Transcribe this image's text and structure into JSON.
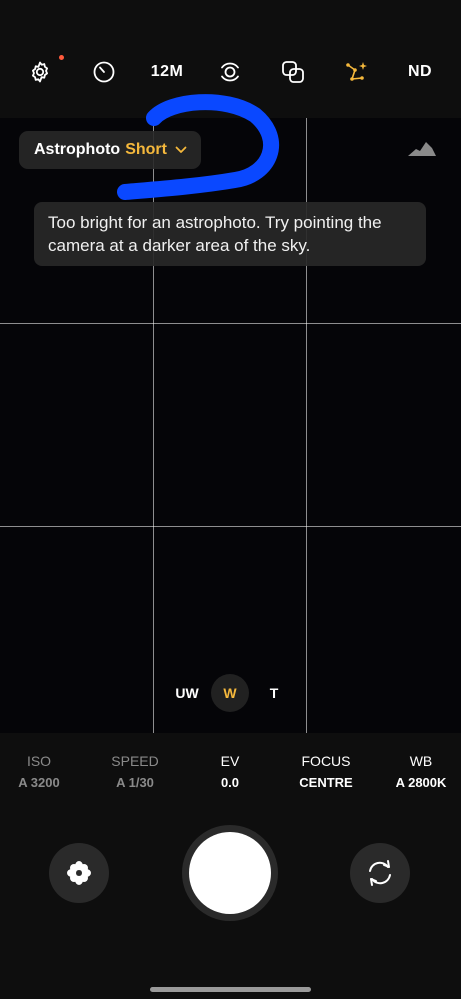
{
  "top_bar": {
    "settings_icon": "gear-icon",
    "settings_badge_color": "#ff5a3c",
    "timer_icon": "timer-icon",
    "resolution": "12M",
    "motion_icon": "motion-photo-icon",
    "effects_icon": "overlap-squares-icon",
    "astro_icon": "constellation-icon",
    "astro_color": "#f5b83c",
    "nd_label": "ND"
  },
  "mode_chip": {
    "prefix": "Astrophoto",
    "accent_word": "Short",
    "chevron_icon": "chevron-down-icon"
  },
  "histogram_icon": "mountain-icon",
  "hint_message": "Too bright for an astrophoto. Try pointing the camera at a darker area of the sky.",
  "annotation": {
    "color": "#0a48ff"
  },
  "zoom": {
    "options": [
      "UW",
      "W",
      "T"
    ],
    "selected": "W"
  },
  "params": [
    {
      "label": "ISO",
      "value": "A 3200"
    },
    {
      "label": "SPEED",
      "value": "A 1/30"
    },
    {
      "label": "EV",
      "value": "0.0"
    },
    {
      "label": "FOCUS",
      "value": "CENTRE"
    },
    {
      "label": "WB",
      "value": "A 2800K"
    }
  ],
  "left_button_icon": "flower-icon",
  "right_button_icon": "switch-camera-icon"
}
